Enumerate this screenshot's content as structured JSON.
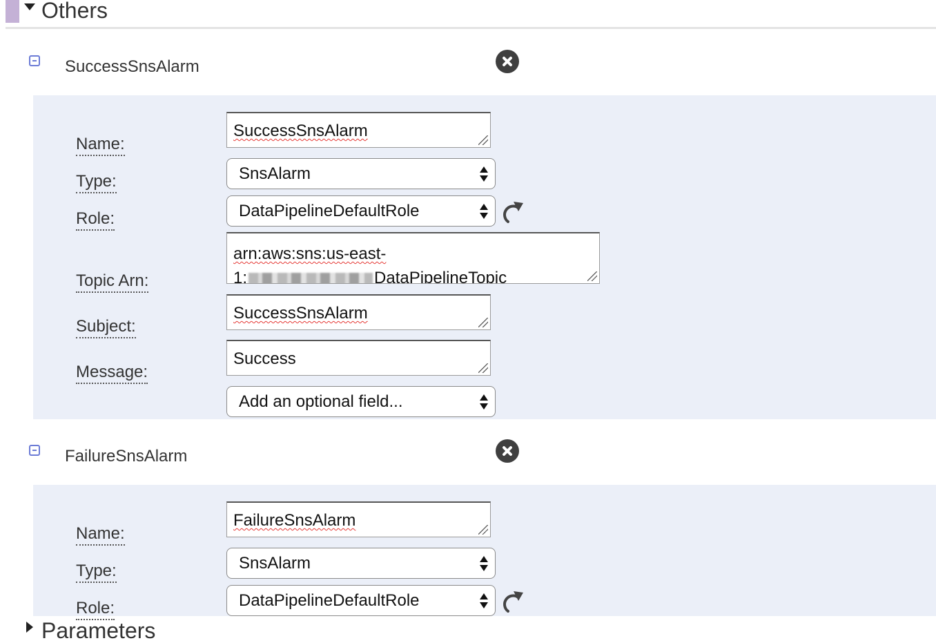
{
  "section": {
    "title": "Others",
    "next_section_title": "Parameters"
  },
  "objects": [
    {
      "title": "SuccessSnsAlarm",
      "labels": {
        "name": "Name:",
        "type": "Type:",
        "role": "Role:",
        "topic_arn": "Topic Arn:",
        "subject": "Subject:",
        "message": "Message:"
      },
      "fields": {
        "name": "SuccessSnsAlarm",
        "type": "SnsAlarm",
        "role": "DataPipelineDefaultRole",
        "topic_arn_line1": "arn:aws:sns:us-east-",
        "topic_arn_line2_prefix": "1:",
        "topic_arn_line2_suffix": "DataPipelineTopic",
        "subject": "SuccessSnsAlarm",
        "message": "Success"
      },
      "optional_field_placeholder": "Add an optional field..."
    },
    {
      "title": "FailureSnsAlarm",
      "labels": {
        "name": "Name:",
        "type": "Type:",
        "role": "Role:"
      },
      "fields": {
        "name": "FailureSnsAlarm",
        "type": "SnsAlarm",
        "role": "DataPipelineDefaultRole"
      }
    }
  ],
  "colors": {
    "panel_bg": "#ebeff8",
    "accent_bar": "#c4b1d6",
    "collapse_icon": "#6b7bd6",
    "close_icon": "#3f3f3f",
    "spellcheck_underline": "#e53935"
  },
  "icons": {
    "section_toggle": "triangle-down-icon",
    "collapse": "minus-square-icon",
    "delete": "close-circle-icon",
    "refresh": "refresh-icon"
  }
}
